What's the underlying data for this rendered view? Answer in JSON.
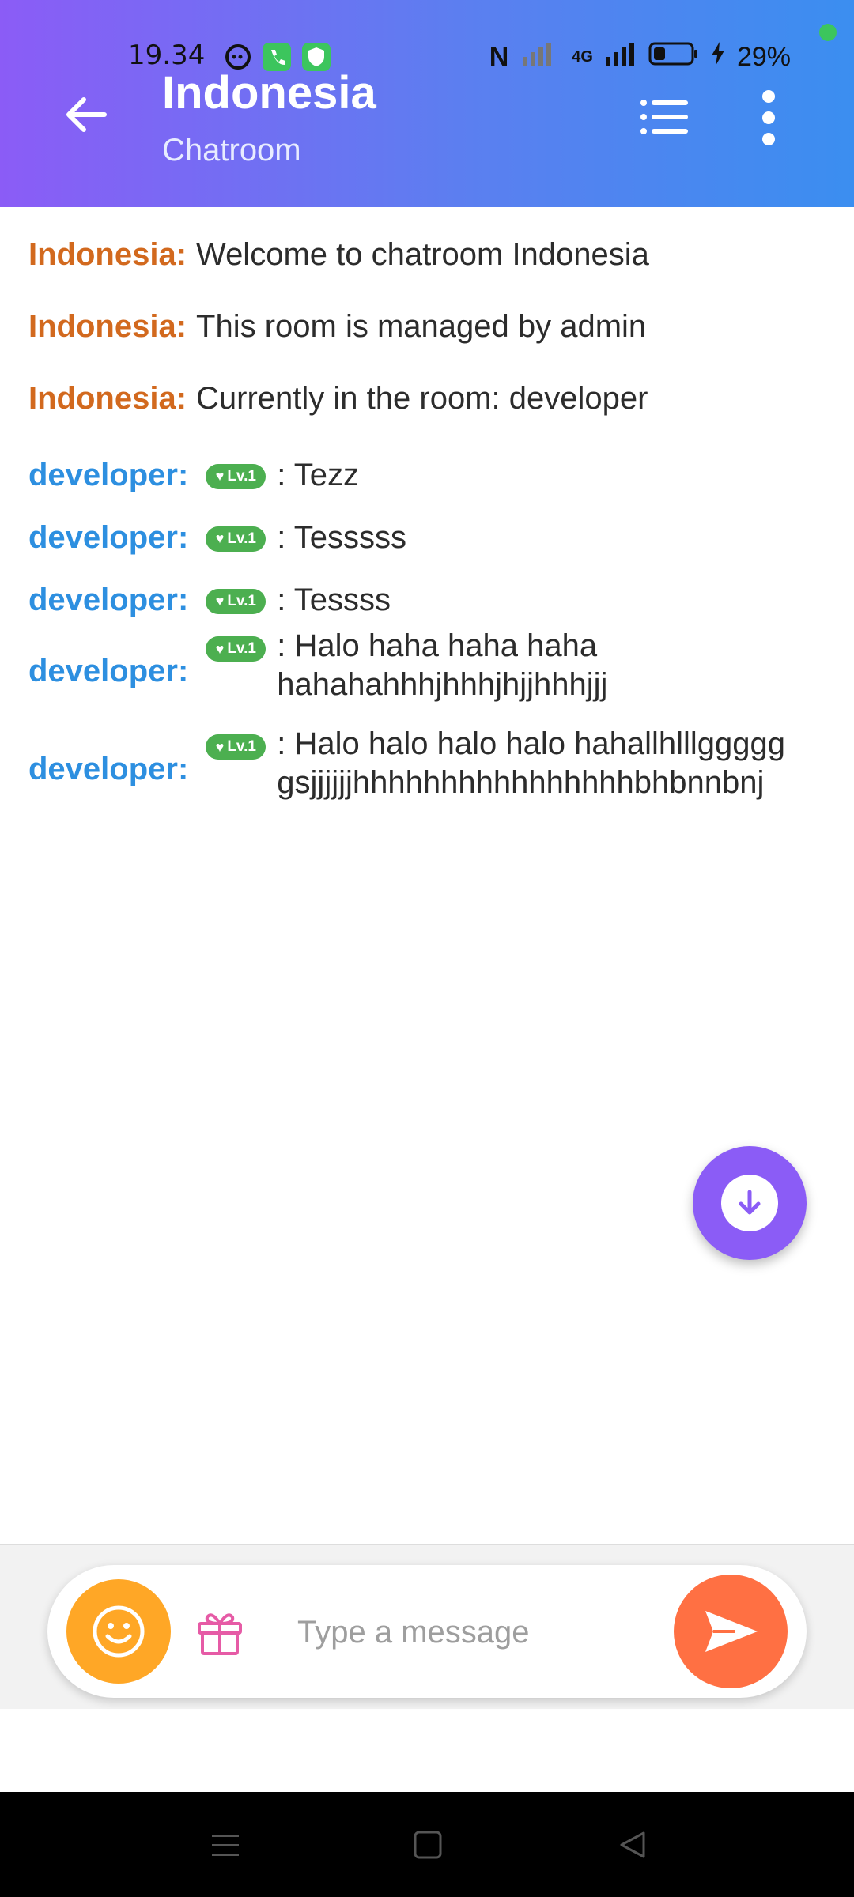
{
  "status_bar": {
    "time": "19.34",
    "network": "4G",
    "battery": "29%"
  },
  "header": {
    "title": "Indonesia",
    "subtitle": "Chatroom"
  },
  "icons": {
    "back": "arrow-left-icon",
    "list": "list-icon",
    "more": "more-vertical-icon",
    "scroll": "arrow-down-icon",
    "emoji": "smiley-icon",
    "gift": "gift-icon",
    "send": "send-icon"
  },
  "system_messages": [
    {
      "name": "Indonesia:",
      "text": "Welcome to chatroom Indonesia"
    },
    {
      "name": "Indonesia:",
      "text": "This room is managed by admin"
    },
    {
      "name": "Indonesia:",
      "text": "Currently in the room: developer"
    }
  ],
  "user_messages": [
    {
      "name": "developer:",
      "level": "Lv.1",
      "text": ": Tezz"
    },
    {
      "name": "developer:",
      "level": "Lv.1",
      "text": ": Tesssss"
    },
    {
      "name": "developer:",
      "level": "Lv.1",
      "text": ": Tessss"
    },
    {
      "name": "developer:",
      "level": "Lv.1",
      "text": ": Halo haha haha haha hahahahhhjhhhjhjjhhhjjj"
    },
    {
      "name": "developer:",
      "level": "Lv.1",
      "text": ": Halo halo halo halo hahallhlllggggg gsjjjjjjhhhhhhhhhhhhhhhhbhbnnbnj"
    }
  ],
  "composer": {
    "placeholder": "Type a message"
  },
  "colors": {
    "system_name": "#d2691e",
    "user_name": "#2d8fe0",
    "badge": "#4caf50",
    "accent": "#8b5cf6",
    "send": "#ff7043",
    "emoji": "#ffa726"
  }
}
